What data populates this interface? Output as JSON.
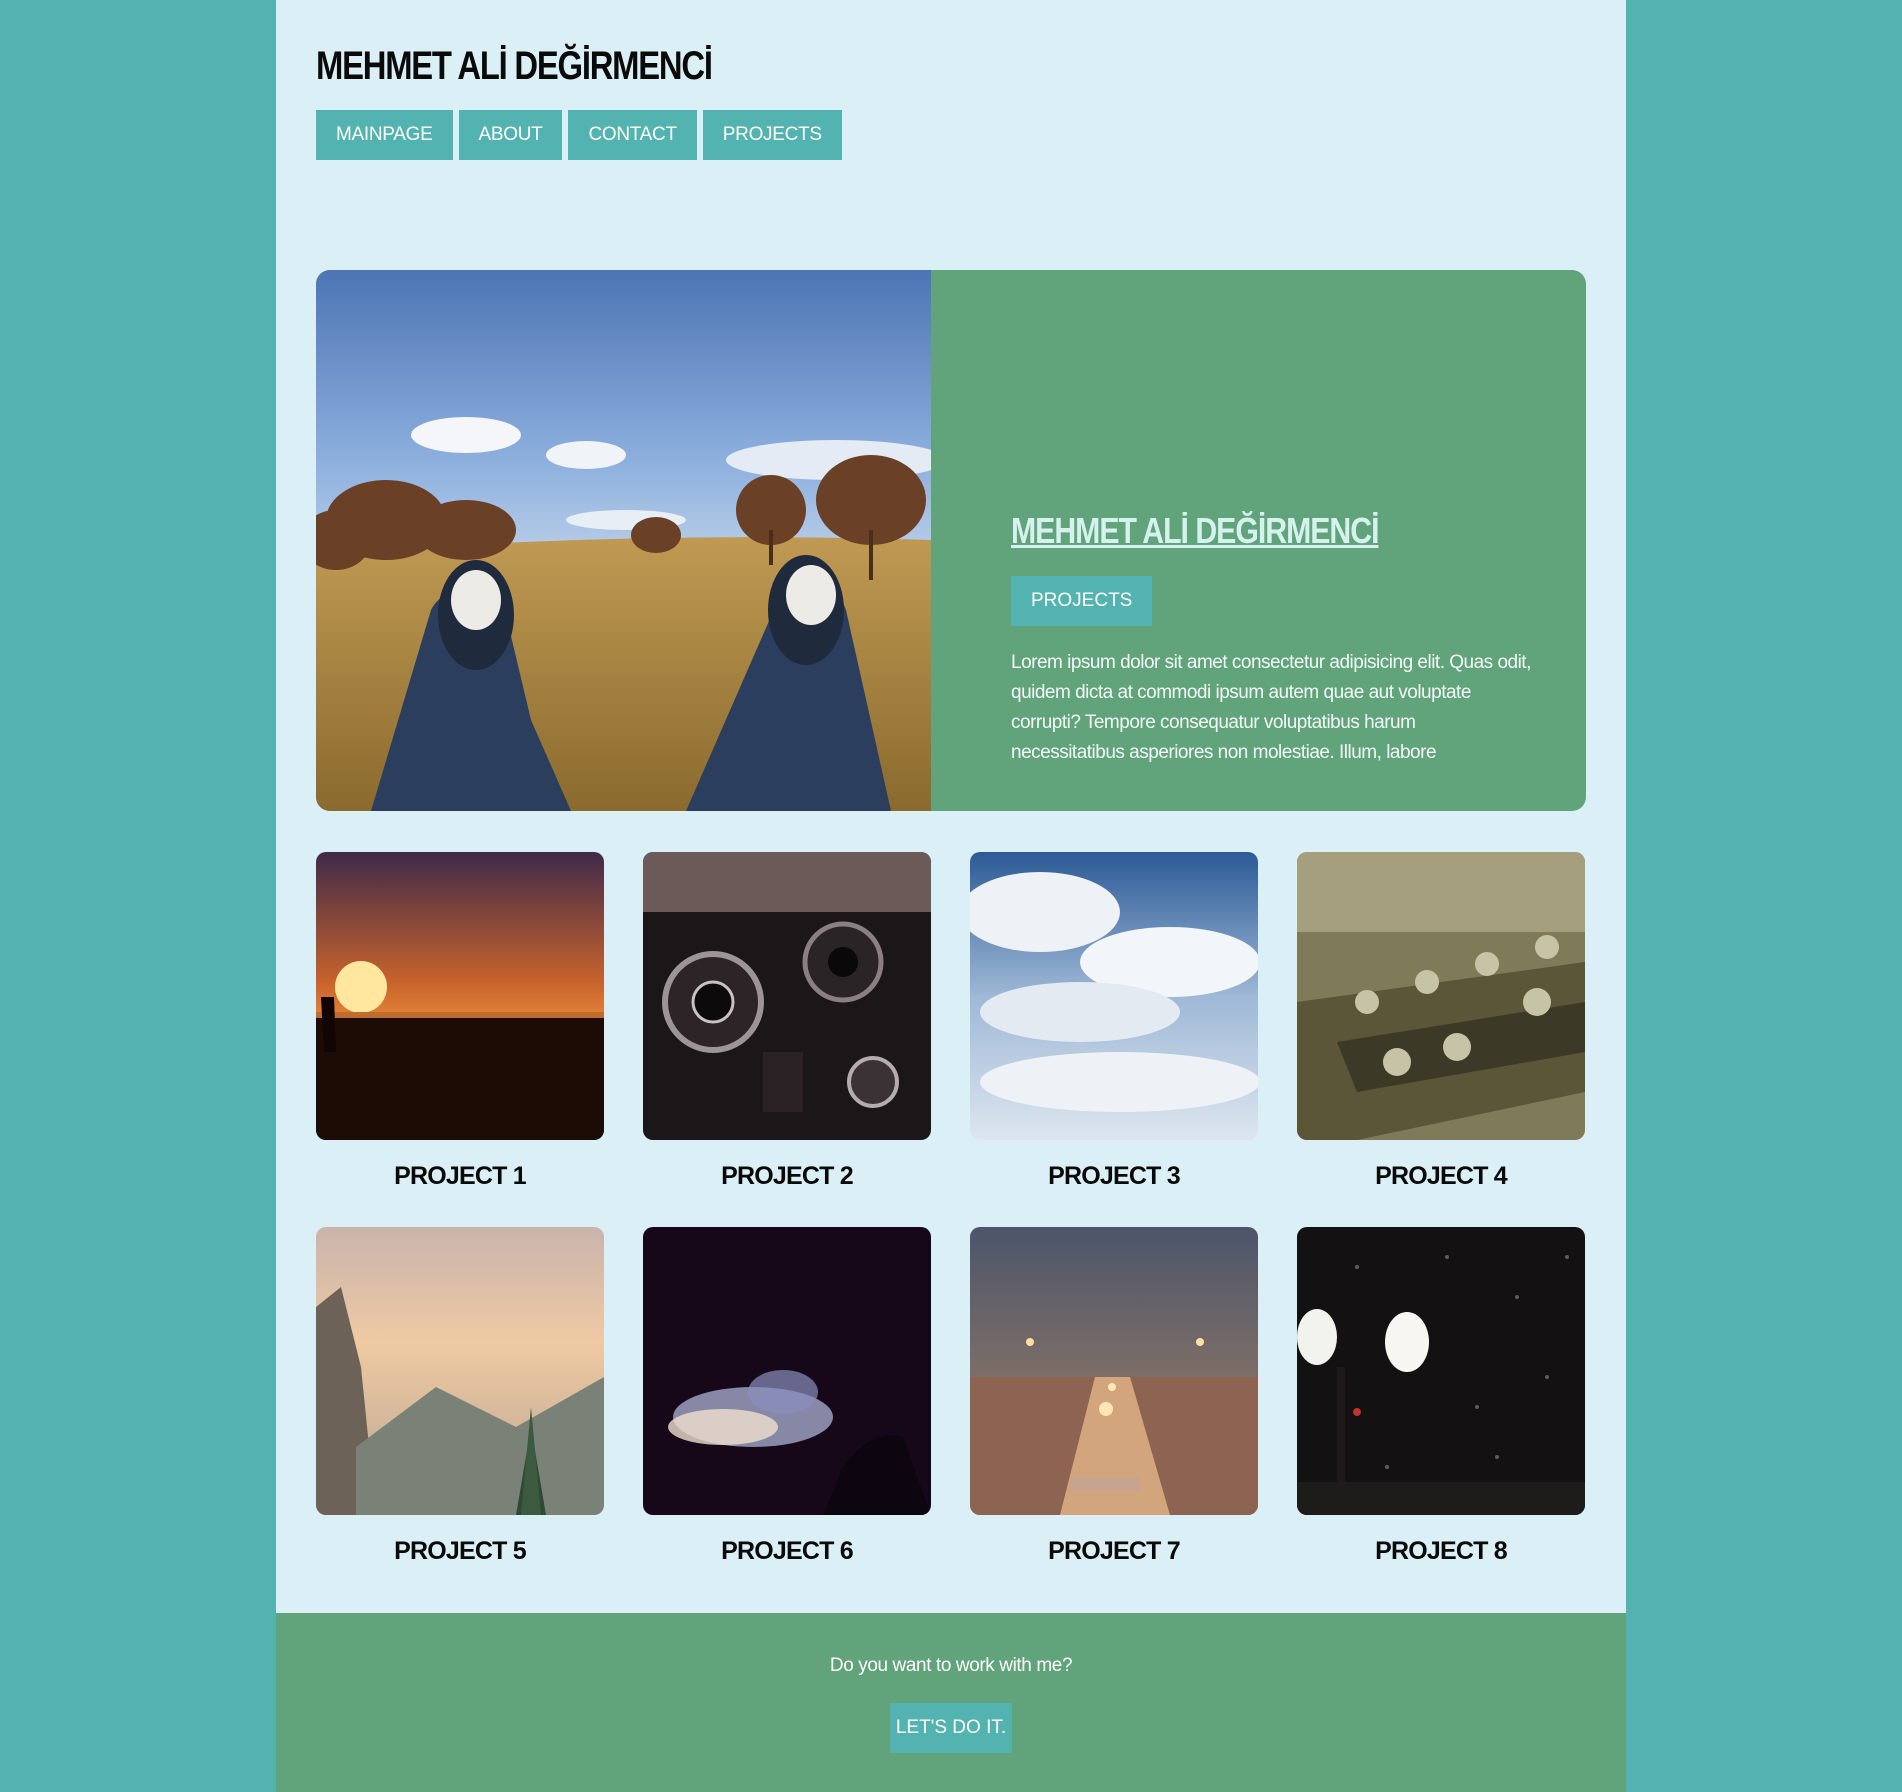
{
  "site": {
    "title": "MEHMET ALİ DEĞİRMENCİ"
  },
  "nav": {
    "items": [
      {
        "label": "MAINPAGE"
      },
      {
        "label": "ABOUT"
      },
      {
        "label": "CONTACT"
      },
      {
        "label": "PROJECTS"
      }
    ]
  },
  "hero": {
    "title": "MEHMET ALİ DEĞİRMENCİ",
    "button_label": "PROJECTS",
    "text": "Lorem ipsum dolor sit amet consectetur adipisicing elit. Quas odit, quidem dicta at commodi ipsum autem quae aut voluptate corrupti? Tempore consequatur voluptatibus harum necessitatibus asperiores non molestiae. Illum, labore"
  },
  "projects": [
    {
      "label": "PROJECT 1"
    },
    {
      "label": "PROJECT 2"
    },
    {
      "label": "PROJECT 3"
    },
    {
      "label": "PROJECT 4"
    },
    {
      "label": "PROJECT 5"
    },
    {
      "label": "PROJECT 6"
    },
    {
      "label": "PROJECT 7"
    },
    {
      "label": "PROJECT 8"
    }
  ],
  "footer": {
    "text": "Do you want to work with me?",
    "button_label": "LET'S DO IT."
  },
  "colors": {
    "background": "#53b3b1",
    "page": "#dbf0f6",
    "accent": "#53b3b1",
    "green": "#61a37a"
  }
}
